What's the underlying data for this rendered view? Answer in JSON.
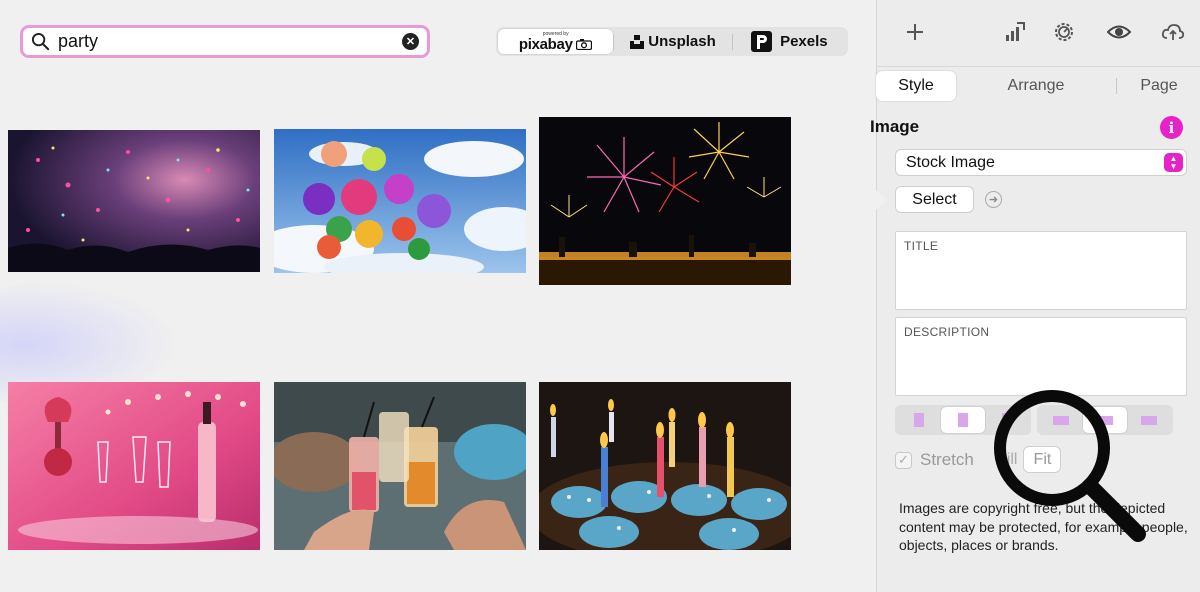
{
  "search": {
    "value": "party"
  },
  "providers": {
    "pixabay": {
      "small": "powered by",
      "label": "pixabay"
    },
    "unsplash": {
      "label": "Unsplash"
    },
    "pexels": {
      "label": "Pexels"
    }
  },
  "images": [
    {
      "name": "confetti-crowd"
    },
    {
      "name": "balloons-sky"
    },
    {
      "name": "fireworks-city"
    },
    {
      "name": "champagne-glasses"
    },
    {
      "name": "cocktail-toast"
    },
    {
      "name": "birthday-cupcakes"
    }
  ],
  "inspector": {
    "tabs": {
      "style": "Style",
      "arrange": "Arrange",
      "page": "Page"
    },
    "section_title": "Image",
    "info_glyph": "i",
    "source_select": "Stock Image",
    "select_button": "Select",
    "title_field_label": "TITLE",
    "description_field_label": "DESCRIPTION",
    "stretch_label": "Stretch",
    "fill_label": "Fill",
    "fit_label": "Fit",
    "copyright_note": "Images are copyright free, but the depicted content may be protected, for example people, objects, places or brands."
  },
  "colors": {
    "accent": "#e523c8",
    "search_border": "#e79ad6"
  }
}
